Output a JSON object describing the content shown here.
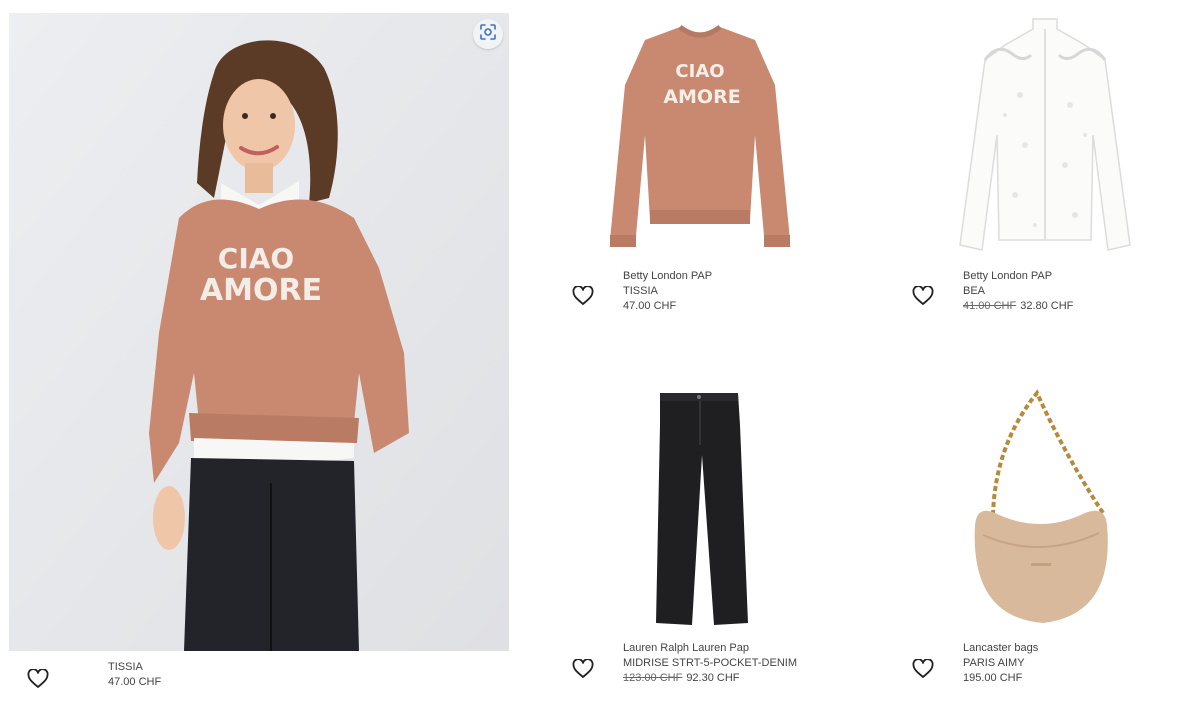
{
  "hero": {
    "name": "TISSIA",
    "price": "47.00 CHF"
  },
  "products": [
    {
      "brand": "Betty London PAP",
      "name": "TISSIA",
      "old_price": "",
      "price": "47.00 CHF",
      "print_line1": "CIAO",
      "print_line2": "AMORE"
    },
    {
      "brand": "Betty London PAP",
      "name": "BEA",
      "old_price": "41.00 CHF",
      "price": "32.80 CHF"
    },
    {
      "brand": "Lauren Ralph Lauren Pap",
      "name": "MIDRISE STRT-5-POCKET-DENIM",
      "old_price": "123.00 CHF",
      "price": "92.30 CHF"
    },
    {
      "brand": "Lancaster bags",
      "name": "PARIS AIMY",
      "old_price": "",
      "price": "195.00 CHF"
    }
  ],
  "hero_print": {
    "line1": "CIAO",
    "line2": "AMORE"
  },
  "icons": {
    "favorite": "heart-outline-icon",
    "visual_search": "lens-scan-icon"
  }
}
